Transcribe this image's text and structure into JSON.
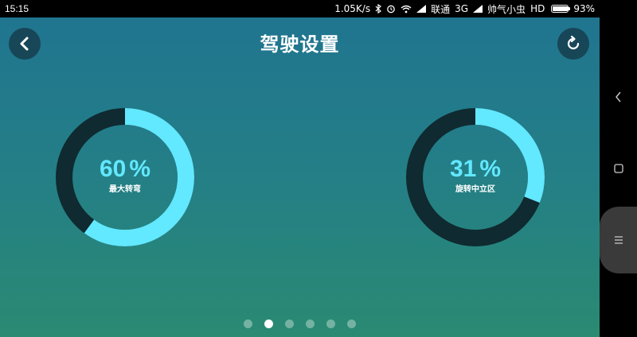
{
  "status_bar": {
    "time": "15:15",
    "speed": "1.05K/s",
    "carrier1": "联通",
    "network": "3G",
    "carrier2": "帅气小虫",
    "hd": "HD",
    "battery": "93%",
    "battery_level": 0.93
  },
  "header": {
    "title": "驾驶设置",
    "back_icon": "chevron-left-icon",
    "reset_icon": "refresh-icon"
  },
  "gauges": [
    {
      "value": "60",
      "unit": "%",
      "label": "最大转弯",
      "fraction": 0.6
    },
    {
      "value": "31",
      "unit": "%",
      "label": "旋转中立区",
      "fraction": 0.31
    }
  ],
  "colors": {
    "gauge_fill": "#62e8ff",
    "gauge_track": "#0f2a30",
    "bg_top": "#20758f",
    "bg_bottom": "#2a8a72"
  },
  "pager": {
    "count": 6,
    "active_index": 1
  }
}
